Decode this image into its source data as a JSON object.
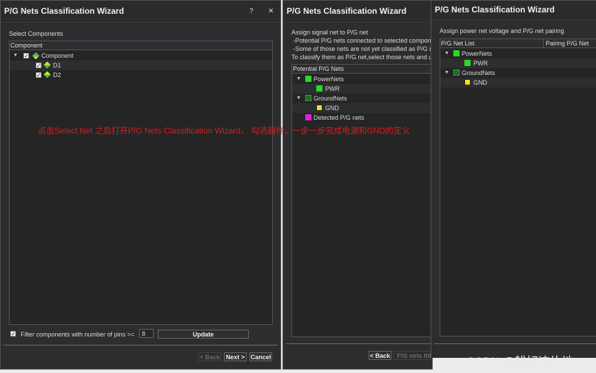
{
  "dialog1": {
    "title": "P/G Nets Classification Wizard",
    "help_label": "?",
    "close_label": "✕",
    "section_label": "Select Components",
    "column_header": "Component",
    "tree": {
      "root_label": "Component",
      "children": [
        "D1",
        "D2"
      ]
    },
    "filter_label": "Filter components with number of pins >=",
    "filter_value": "8",
    "update_label": "Update",
    "back_label": "< Back",
    "next_label": "Next >",
    "cancel_label": "Cancel"
  },
  "dialog2": {
    "title": "P/G Nets Classification Wizard",
    "instructions": [
      "Assign signal net to P/G net",
      " -Potential P/G nets connected to selected componer",
      " -Some of those nets are not yet classified as P/G ne",
      "To classify them as P/G net,select those nets and use"
    ],
    "column_header": "Potential P/G Nets",
    "power_group": "PowerNets",
    "power_net": "PWR",
    "ground_group": "GroundNets",
    "ground_net": "GND",
    "detected_label": "Detected P/G nets",
    "back_label": "< Back",
    "next_label": "P/G nets filt"
  },
  "dialog3": {
    "title": "P/G Nets Classification Wizard",
    "instruction": "Assign power net voltage and P/G net pairing",
    "columns": [
      "P/G Net List",
      "Pairing P/G Net"
    ],
    "power_group": "PowerNets",
    "power_net": "PWR",
    "ground_group": "GroundNets",
    "ground_net": "GND"
  },
  "annotation": "点击Select Net 之后打开P/G Nets Classification Wizard，  勾选器件，一步一步完成电源和GND的定义",
  "watermark": "CSDN @耕好这片地",
  "colors": {
    "power_green": "#22dd22",
    "ground_green": "#2a7a2a",
    "gnd_yellow": "#f0e020",
    "detected_magenta": "#e020e0",
    "annotation_red": "#d81e1e",
    "panel_bg": "#2d2d30"
  }
}
